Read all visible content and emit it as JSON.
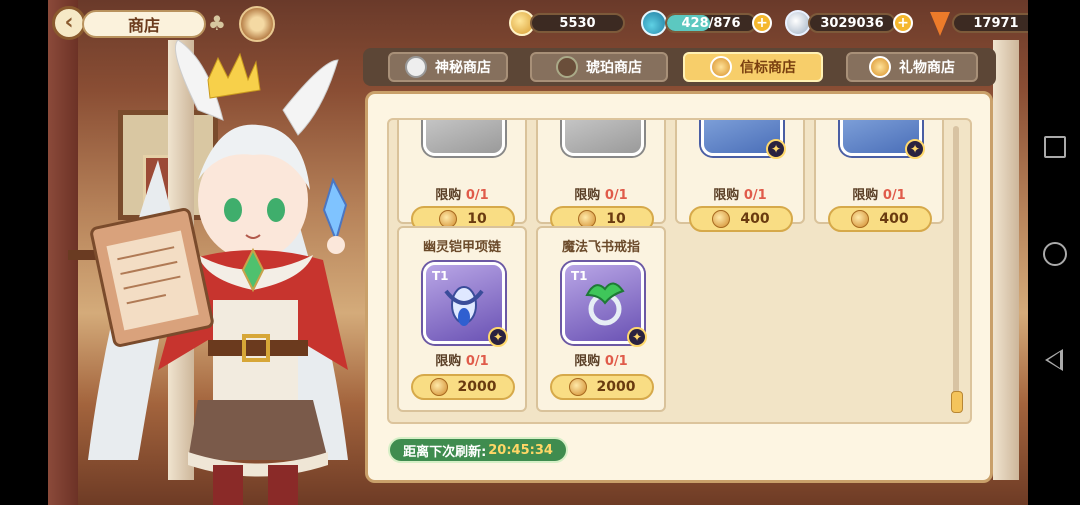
{
  "header": {
    "title": "商店",
    "back_icon": "back-arrow-icon",
    "clover_icon": "clover-icon",
    "emblem_icon": "emblem-icon"
  },
  "resources": [
    {
      "name": "coin",
      "value": "5530"
    },
    {
      "name": "stamina",
      "value": "428/876",
      "fill": 0.49
    },
    {
      "name": "gem",
      "value": "3029036"
    },
    {
      "name": "carrot",
      "value": "17971"
    }
  ],
  "tabs": [
    {
      "label": "神秘商店",
      "icon": "mystery-icon",
      "active": false
    },
    {
      "label": "琥珀商店",
      "icon": "amber-icon",
      "active": false
    },
    {
      "label": "信标商店",
      "icon": "beacon-icon",
      "active": true
    },
    {
      "label": "礼物商店",
      "icon": "gift-icon",
      "active": false
    }
  ],
  "items": [
    {
      "name": "",
      "limit_prefix": "限购",
      "limit": "0/1",
      "price": "10",
      "rarity": "grey"
    },
    {
      "name": "",
      "limit_prefix": "限购",
      "limit": "0/1",
      "price": "10",
      "rarity": "grey"
    },
    {
      "name": "",
      "limit_prefix": "限购",
      "limit": "0/1",
      "price": "400",
      "rarity": "blue"
    },
    {
      "name": "",
      "limit_prefix": "限购",
      "limit": "0/1",
      "price": "400",
      "rarity": "blue"
    },
    {
      "name": "幽灵铠甲项链",
      "tier": "T1",
      "limit_prefix": "限购",
      "limit": "0/1",
      "price": "2000",
      "rarity": "purple"
    },
    {
      "name": "魔法飞书戒指",
      "tier": "T1",
      "limit_prefix": "限购",
      "limit": "0/1",
      "price": "2000",
      "rarity": "purple"
    }
  ],
  "refresh": {
    "label": "距离下次刷新:",
    "timer": "20:45:34"
  },
  "system_nav": [
    "recent-apps-icon",
    "home-icon",
    "back-icon"
  ]
}
